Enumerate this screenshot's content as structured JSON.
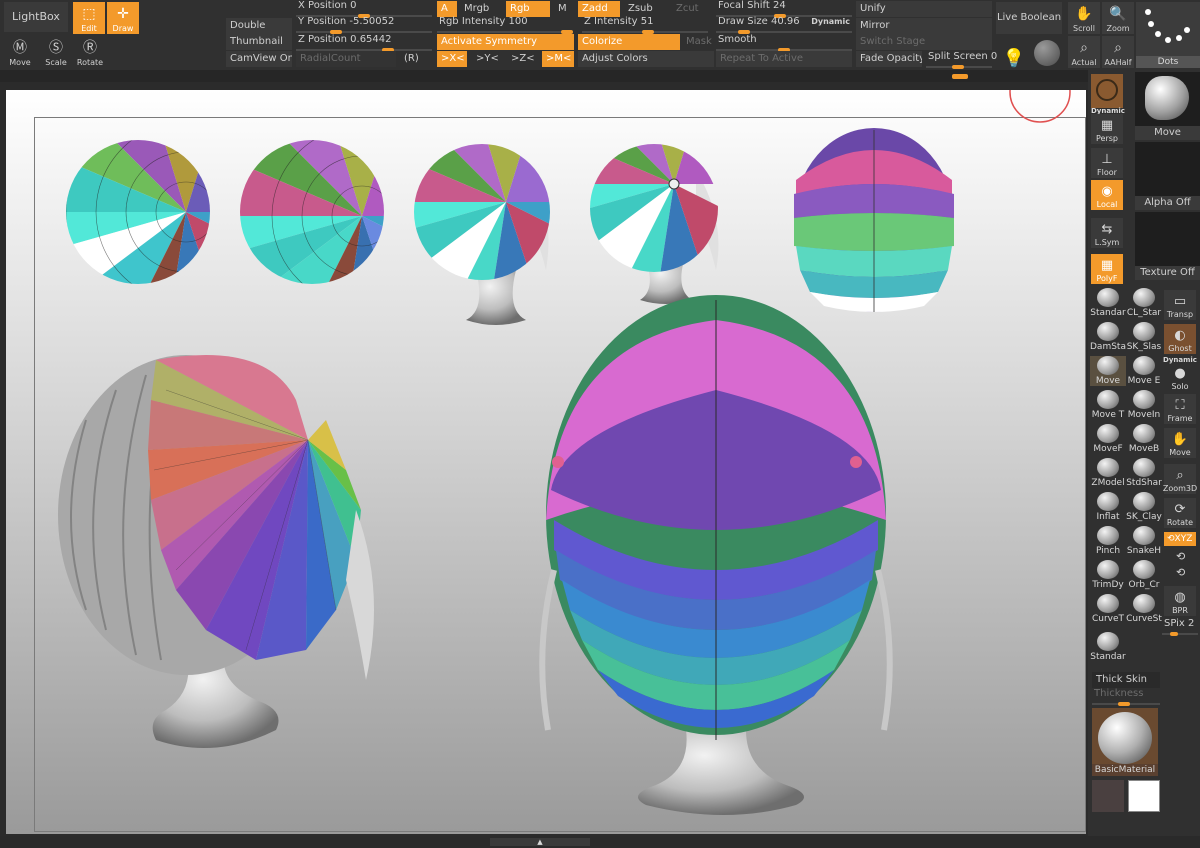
{
  "left_buttons": {
    "lightbox": "LightBox",
    "edit": "Edit",
    "draw": "Draw",
    "move": "Move",
    "scale": "Scale",
    "rotate": "Rotate"
  },
  "col_display": {
    "double": "Double",
    "thumbnail": "Thumbnail",
    "camview": "CamView On"
  },
  "position": {
    "x_label": "X Position",
    "x_value": "0",
    "y_label": "Y Position",
    "y_value": "-5.50052",
    "z_label": "Z Position",
    "z_value": "0.65442",
    "radial_count": "RadialCount",
    "r_label": "(R)"
  },
  "material_mode": {
    "a": "A",
    "mrgb": "Mrgb",
    "rgb": "Rgb",
    "m": "M",
    "rgb_intensity_label": "Rgb Intensity",
    "rgb_intensity_value": "100",
    "activate_symmetry": "Activate Symmetry",
    "sym_x": ">X<",
    "sym_y": ">Y<",
    "sym_z": ">Z<",
    "sym_m": ">M<"
  },
  "z_mode": {
    "zadd": "Zadd",
    "zsub": "Zsub",
    "zcut": "Zcut",
    "z_intensity_label": "Z Intensity",
    "z_intensity_value": "51",
    "colorize": "Colorize",
    "mask": "Mask",
    "adjust_colors": "Adjust Colors"
  },
  "draw_settings": {
    "focal_shift_label": "Focal Shift",
    "focal_shift_value": "24",
    "draw_size_label": "Draw Size",
    "draw_size_value": "40.96",
    "dynamic": "Dynamic",
    "smooth": "Smooth",
    "repeat_to_active": "Repeat To Active"
  },
  "mesh_ops": {
    "unify": "Unify",
    "mirror": "Mirror",
    "switch_stage": "Switch Stage",
    "fade_opacity": "Fade Opacity",
    "split_screen_label": "Split Screen",
    "split_screen_value": "0",
    "live_boolean": "Live Boolean"
  },
  "view_tools": {
    "scroll": "Scroll",
    "zoom": "Zoom",
    "actual": "Actual",
    "aahalf": "AAHalf",
    "dots": "Dots"
  },
  "right_shelf": {
    "dynamic": "Dynamic",
    "persp": "Persp",
    "floor": "Floor",
    "local": "Local",
    "lsym": "L.Sym",
    "polyf": "PolyF",
    "transp": "Transp",
    "ghost": "Ghost",
    "dynamic2": "Dynamic",
    "solo": "Solo",
    "frame": "Frame",
    "move": "Move",
    "zoom3d": "Zoom3D",
    "rotate": "Rotate",
    "xyz": "XYZ",
    "bpr": "BPR",
    "spix_label": "SPix",
    "spix_value": "2"
  },
  "brushes": [
    "Standar",
    "CL_Star",
    "DamSta",
    "SK_Slas",
    "Move",
    "Move E",
    "Move T",
    "MoveIn",
    "MoveF",
    "MoveB",
    "ZModel",
    "StdShar",
    "Inflat",
    "SK_Clay",
    "Pinch",
    "SnakeH",
    "TrimDy",
    "Orb_Cr",
    "CurveT",
    "CurveSt",
    "Standar"
  ],
  "thick_skin": "Thick Skin",
  "thickness": "Thickness",
  "material_name": "BasicMaterial",
  "thumbs": {
    "move": "Move",
    "alpha": "Alpha Off",
    "texture": "Texture Off"
  },
  "colors": {
    "accent": "#f39a2b",
    "panel": "#303030",
    "button": "#3a3a3a"
  }
}
